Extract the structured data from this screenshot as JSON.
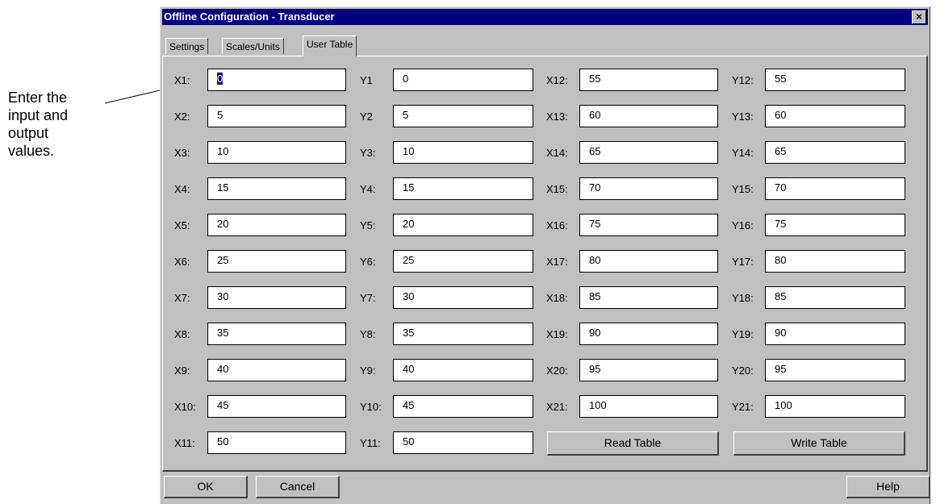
{
  "annotation": "Enter the input and output values.",
  "dialog": {
    "title": "Offline Configuration - Transducer",
    "close_label": "×"
  },
  "tabs": [
    "Settings",
    "Scales/Units",
    "User Table"
  ],
  "table": {
    "rows": [
      {
        "x_label": "X1:",
        "x_val": "0",
        "y_label": "Y1",
        "y_val": "0"
      },
      {
        "x_label": "X2:",
        "x_val": "5",
        "y_label": "Y2",
        "y_val": "5"
      },
      {
        "x_label": "X3:",
        "x_val": "10",
        "y_label": "Y3:",
        "y_val": "10"
      },
      {
        "x_label": "X4:",
        "x_val": "15",
        "y_label": "Y4:",
        "y_val": "15"
      },
      {
        "x_label": "X5:",
        "x_val": "20",
        "y_label": "Y5:",
        "y_val": "20"
      },
      {
        "x_label": "X6:",
        "x_val": "25",
        "y_label": "Y6:",
        "y_val": "25"
      },
      {
        "x_label": "X7:",
        "x_val": "30",
        "y_label": "Y7:",
        "y_val": "30"
      },
      {
        "x_label": "X8:",
        "x_val": "35",
        "y_label": "Y8:",
        "y_val": "35"
      },
      {
        "x_label": "X9:",
        "x_val": "40",
        "y_label": "Y9:",
        "y_val": "40"
      },
      {
        "x_label": "X10:",
        "x_val": "45",
        "y_label": "Y10:",
        "y_val": "45"
      },
      {
        "x_label": "X11:",
        "x_val": "50",
        "y_label": "Y11:",
        "y_val": "50"
      }
    ],
    "rows2": [
      {
        "x_label": "X12:",
        "x_val": "55",
        "y_label": "Y12:",
        "y_val": "55"
      },
      {
        "x_label": "X13:",
        "x_val": "60",
        "y_label": "Y13:",
        "y_val": "60"
      },
      {
        "x_label": "X14:",
        "x_val": "65",
        "y_label": "Y14:",
        "y_val": "65"
      },
      {
        "x_label": "X15:",
        "x_val": "70",
        "y_label": "Y15:",
        "y_val": "70"
      },
      {
        "x_label": "X16:",
        "x_val": "75",
        "y_label": "Y16:",
        "y_val": "75"
      },
      {
        "x_label": "X17:",
        "x_val": "80",
        "y_label": "Y17:",
        "y_val": "80"
      },
      {
        "x_label": "X18:",
        "x_val": "85",
        "y_label": "Y18:",
        "y_val": "85"
      },
      {
        "x_label": "X19:",
        "x_val": "90",
        "y_label": "Y19:",
        "y_val": "90"
      },
      {
        "x_label": "X20:",
        "x_val": "95",
        "y_label": "Y20:",
        "y_val": "95"
      },
      {
        "x_label": "X21:",
        "x_val": "100",
        "y_label": "Y21:",
        "y_val": "100"
      }
    ]
  },
  "buttons": {
    "read_table": "Read Table",
    "write_table": "Write Table",
    "ok": "OK",
    "cancel": "Cancel",
    "help": "Help"
  }
}
